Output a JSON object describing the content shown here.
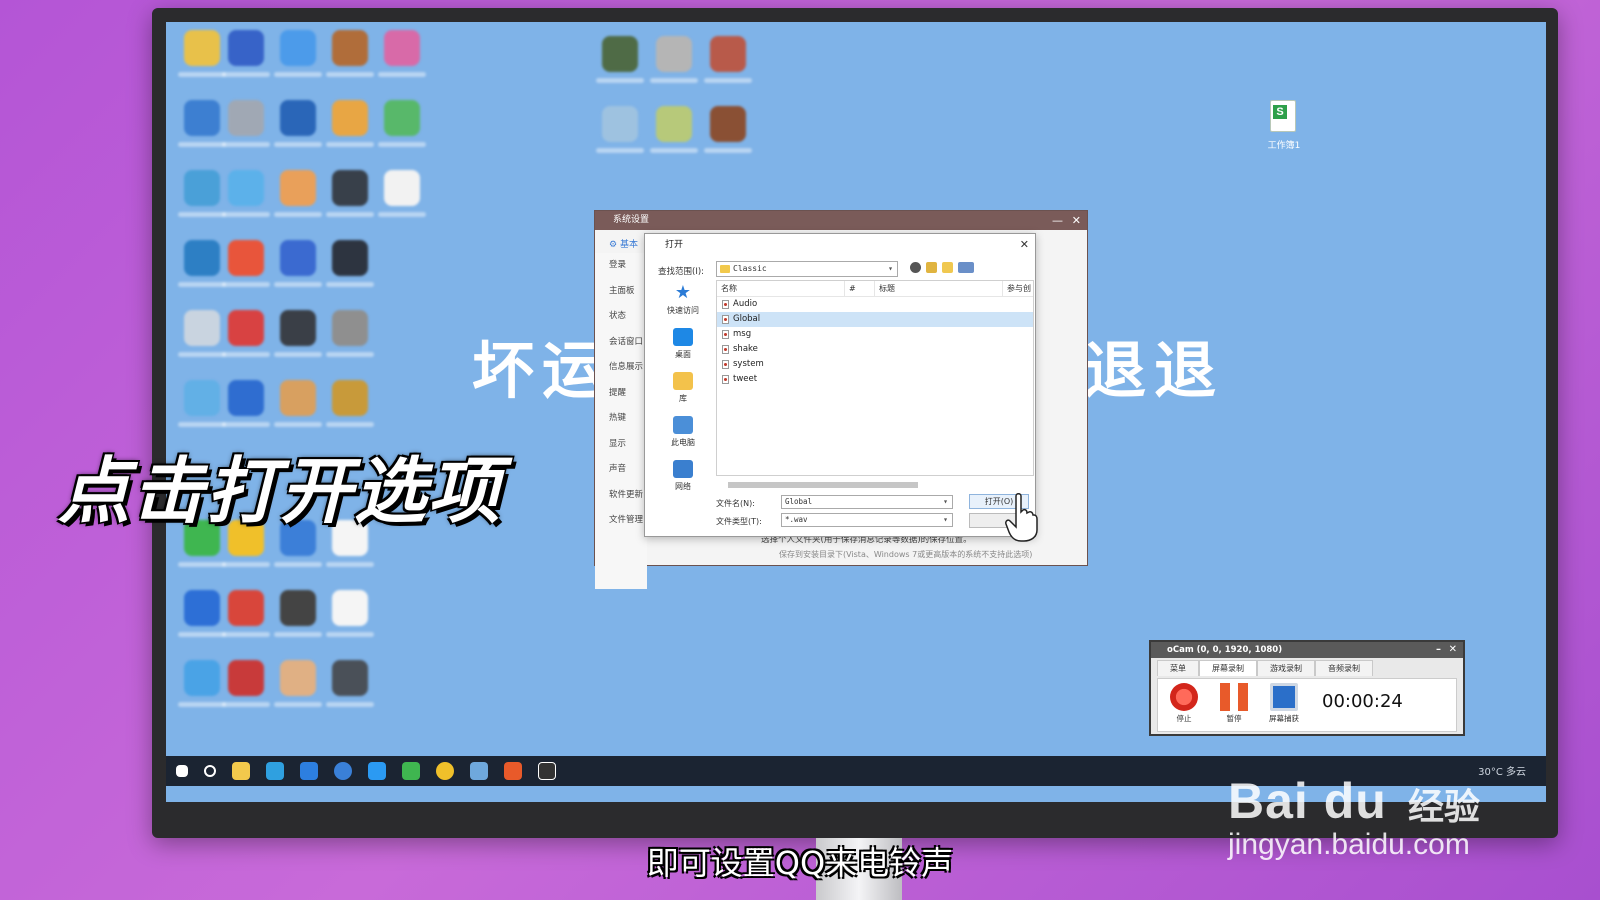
{
  "settings_window": {
    "title": "系统设置",
    "minimize": "—",
    "close": "✕",
    "header_tab": "基本",
    "sidebar": [
      "登录",
      "主面板",
      "状态",
      "会话窗口",
      "信息展示",
      "提醒",
      "热键",
      "显示",
      "声音",
      "软件更新",
      "文件管理"
    ],
    "footer_text": "选择个人文件夹(用于保存消息记录等数据)的保存位置。",
    "footer_note": "保存到安装目录下(Vista、Windows 7或更高版本的系统不支持此选项)"
  },
  "open_dialog": {
    "title": "打开",
    "close": "✕",
    "look_in_label": "查找范围(I):",
    "look_in_value": "Classic",
    "places": [
      "快速访问",
      "桌面",
      "库",
      "此电脑",
      "网络"
    ],
    "columns": [
      "名称",
      "#",
      "标题",
      "参与创"
    ],
    "files": [
      "Audio",
      "Global",
      "msg",
      "shake",
      "system",
      "tweet"
    ],
    "selected_file": "Global",
    "filename_label": "文件名(N):",
    "filename_value": "Global",
    "filetype_label": "文件类型(T):",
    "filetype_value": "*.wav",
    "open_button": "打开(O)"
  },
  "ocam": {
    "title": "oCam (0, 0, 1920, 1080)",
    "tabs": [
      "菜单",
      "屏幕录制",
      "游戏录制",
      "音频录制"
    ],
    "active_tab": "屏幕录制",
    "stop_label": "停止",
    "pause_label": "暂停",
    "capture_label": "屏幕捕获",
    "timer": "00:00:24"
  },
  "desktop": {
    "bg_text_left": "坏运",
    "bg_text_right": "退退",
    "sheet_label": "工作簿1"
  },
  "taskbar": {
    "weather": "30°C 多云"
  },
  "overlay": {
    "caption": "点击打开选项",
    "subtitle": "即可设置QQ来电铃声",
    "watermark_logo": "Bai du",
    "watermark_cn": "经验",
    "watermark_url": "jingyan.baidu.com"
  },
  "colors": {
    "desktop_bg": "#7fb3e8",
    "settings_title_bar": "#7a5b59",
    "selection": "#cde3f7"
  }
}
